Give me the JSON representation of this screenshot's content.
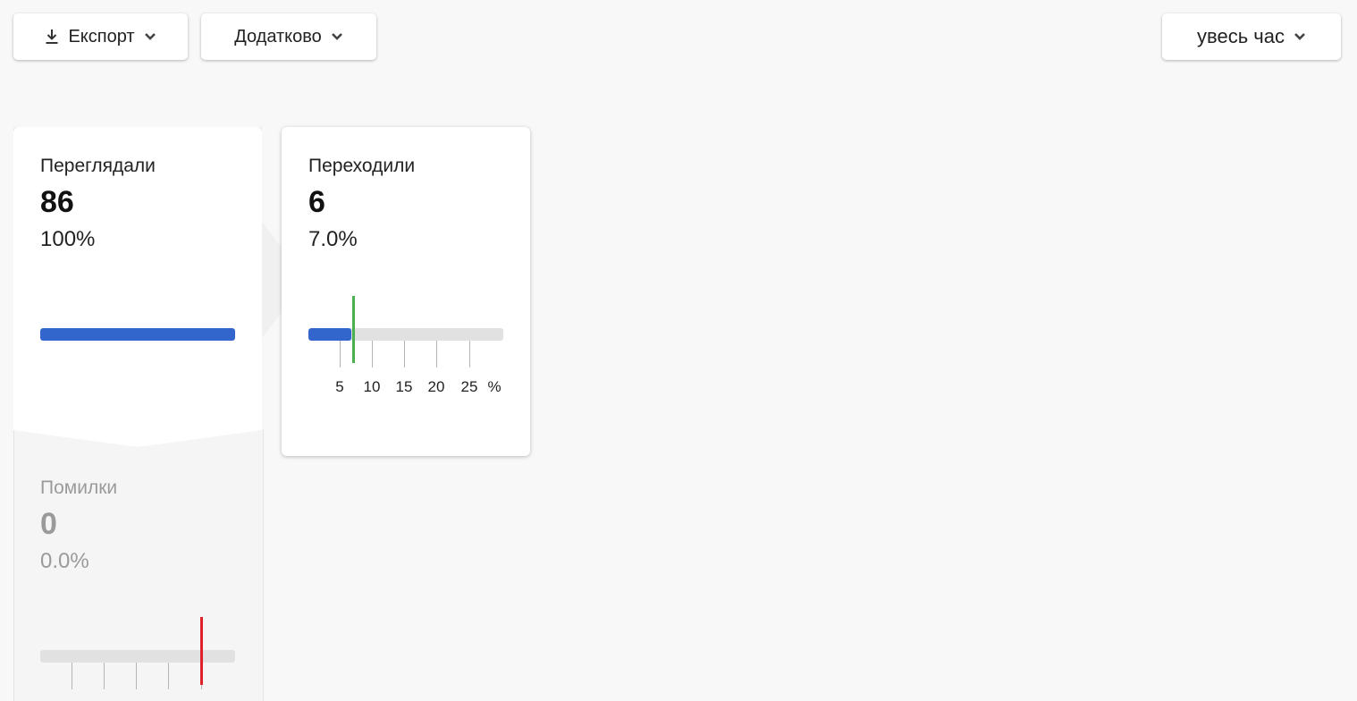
{
  "toolbar": {
    "export_label": "Експорт",
    "more_label": "Додатково",
    "period_label": "увесь час"
  },
  "funnel": {
    "viewed": {
      "title": "Переглядали",
      "value": "86",
      "percent": "100%",
      "fill_fraction": 1.0
    },
    "clicked": {
      "title": "Переходили",
      "value": "6",
      "percent": "7.0%",
      "fill_fraction": 0.07,
      "benchmark_percent": 7.0,
      "benchmark_color": "#4caf50",
      "scale_ticks": [
        "5",
        "10",
        "15",
        "20",
        "25"
      ],
      "scale_unit": "%"
    },
    "errors": {
      "title": "Помилки",
      "value": "0",
      "percent": "0.0%",
      "fill_fraction": 0.0,
      "benchmark_color": "#e0202a"
    }
  },
  "colors": {
    "accent": "#3366cc",
    "track": "#e1e1e1",
    "good": "#4caf50",
    "bad": "#e0202a"
  }
}
